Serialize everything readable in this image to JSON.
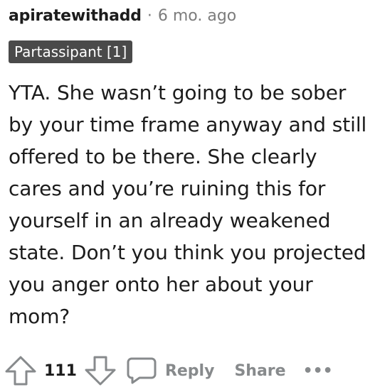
{
  "comment": {
    "username": "apiratewithadd",
    "separator": "·",
    "timestamp": "6 mo. ago",
    "flair": "Partassipant [1]",
    "body": "YTA. She wasn’t going to be sober by your time frame anyway and still offered to be there. She clearly cares and you’re ruining this for yourself in an already weakened state. Don’t you think you projected you anger onto her about your mom?",
    "vote_count": "111"
  },
  "actions": {
    "reply_label": "Reply",
    "share_label": "Share",
    "more_label": "•••"
  },
  "icons": {
    "upvote": "upvote-arrow-icon",
    "downvote": "downvote-arrow-icon",
    "reply": "speech-bubble-icon"
  },
  "colors": {
    "flair_background": "#4a4a4a",
    "muted_text": "#878a8c",
    "text": "#1c1c1c"
  }
}
